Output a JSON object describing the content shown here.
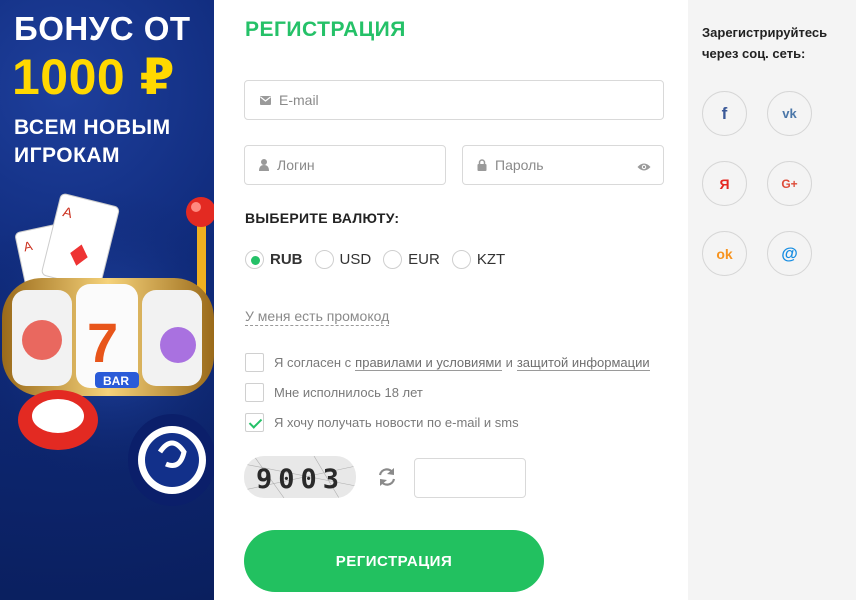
{
  "banner": {
    "line1": "БОНУС ОТ",
    "line2": "1000 ₽",
    "line3": "ВСЕМ НОВЫМ",
    "line4": "ИГРОКАМ"
  },
  "form": {
    "title": "РЕГИСТРАЦИЯ",
    "email_placeholder": "E-mail",
    "login_placeholder": "Логин",
    "password_placeholder": "Пароль",
    "currency_title": "ВЫБЕРИТЕ ВАЛЮТУ:",
    "currencies": [
      {
        "label": "RUB",
        "selected": true
      },
      {
        "label": "USD",
        "selected": false
      },
      {
        "label": "EUR",
        "selected": false
      },
      {
        "label": "KZT",
        "selected": false
      }
    ],
    "promo_link": "У меня есть промокод",
    "agree_prefix": "Я согласен с",
    "agree_rules_link": "правилами и условиями",
    "agree_and": "и",
    "agree_privacy_link": "защитой информации",
    "age_label": "Мне исполнилось 18 лет",
    "news_label": "Я хочу получать новости по e-mail и sms",
    "checkboxes": {
      "agree": false,
      "age": false,
      "news": true
    },
    "captcha_text": "9003",
    "captcha_input_value": "",
    "submit_label": "РЕГИСТРАЦИЯ"
  },
  "social": {
    "title": "Зарегистрируйтесь через соц. сеть:",
    "networks": [
      {
        "name": "facebook",
        "glyph": "f",
        "color": "#3b5998"
      },
      {
        "name": "vkontakte",
        "glyph": "vk",
        "color": "#4a76a8"
      },
      {
        "name": "yandex",
        "glyph": "Я",
        "color": "#e52620"
      },
      {
        "name": "google-plus",
        "glyph": "G+",
        "color": "#dd4b39"
      },
      {
        "name": "odnoklassniki",
        "glyph": "ok",
        "color": "#f7931e"
      },
      {
        "name": "mail-ru",
        "glyph": "@",
        "color": "#168de2"
      }
    ]
  },
  "colors": {
    "accent": "#25c168",
    "banner_bg": "#0f2a7a",
    "bonus_yellow": "#ffd800"
  }
}
